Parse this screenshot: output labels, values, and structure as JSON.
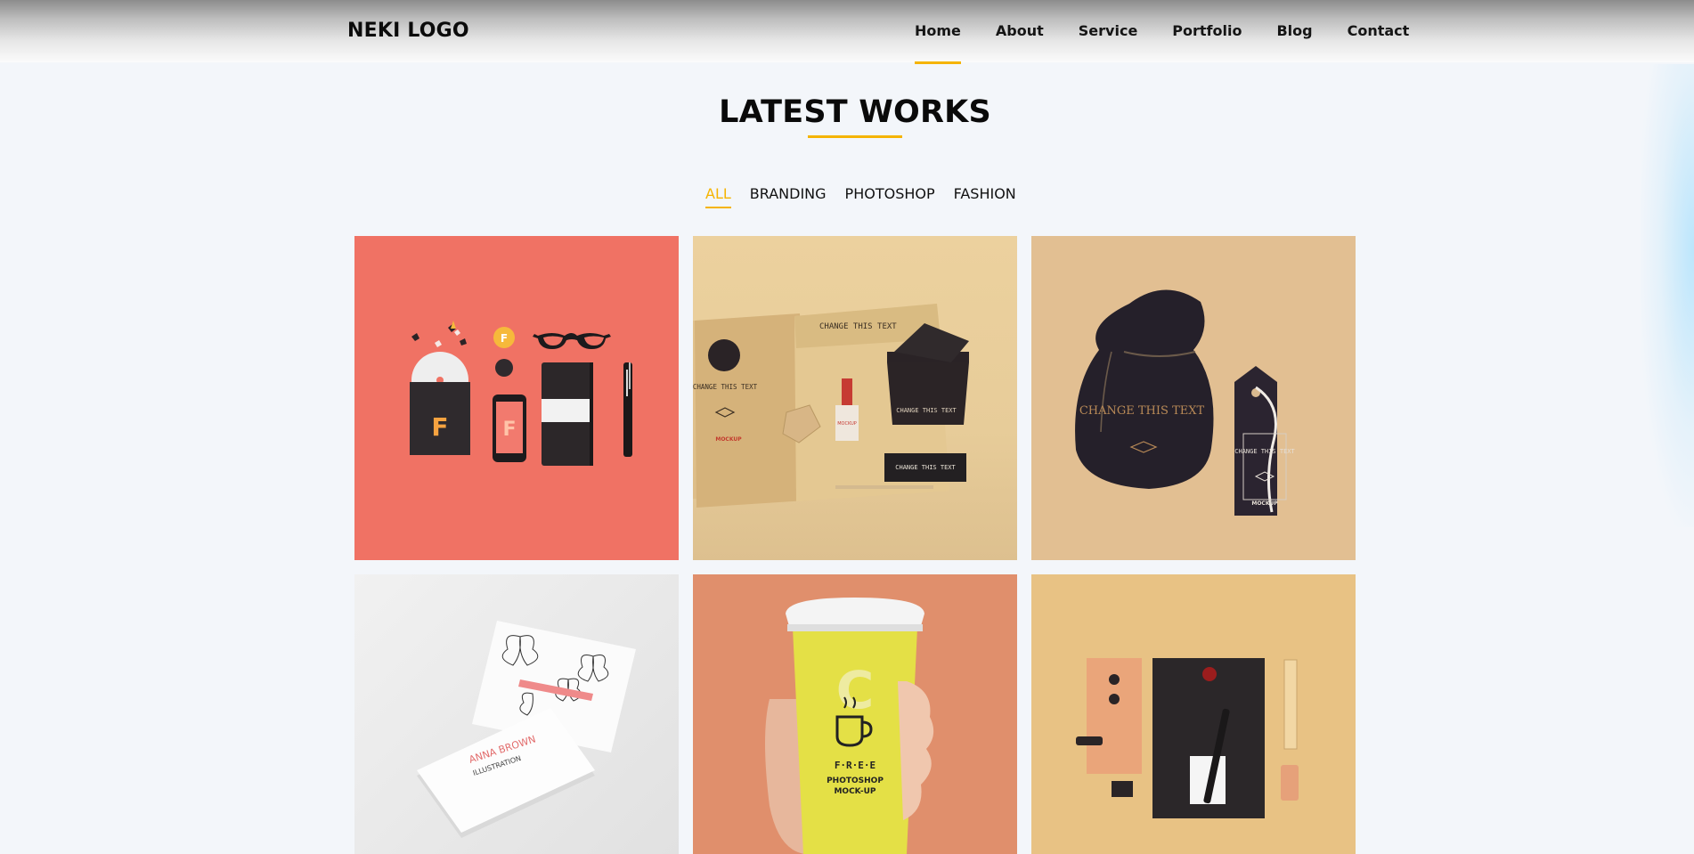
{
  "header": {
    "logo": "NEKI LOGO",
    "nav": [
      {
        "label": "Home",
        "active": true
      },
      {
        "label": "About"
      },
      {
        "label": "Service"
      },
      {
        "label": "Portfolio"
      },
      {
        "label": "Blog"
      },
      {
        "label": "Contact"
      }
    ]
  },
  "section": {
    "title": "LATEST WORKS",
    "filters": [
      {
        "label": "ALL",
        "active": true
      },
      {
        "label": "BRANDING"
      },
      {
        "label": "PHOTOSHOP"
      },
      {
        "label": "FASHION"
      }
    ]
  },
  "tiles": [
    {
      "name": "stationery-flatlay",
      "bg": "#f07264"
    },
    {
      "name": "kraft-packaging",
      "bg": "#e7cc99",
      "texts": {
        "bag_title": "CHANGE THIS TEXT",
        "bag_label": "CHANGE THIS TEXT",
        "bag_mockup": "MOCKUP",
        "ribbon": "MOCKUP",
        "box_title": "CHANGE THIS TEXT",
        "box_front": "CHANGE THIS TEXT"
      }
    },
    {
      "name": "fabric-bag-and-tag",
      "bg": "#e2bf92",
      "texts": {
        "bag": "CHANGE THIS TEXT",
        "tag": "CHANGE THIS TEXT",
        "tag_mockup": "MOCKUP"
      }
    },
    {
      "name": "business-cards",
      "bg": "#e8e8e8",
      "texts": {
        "card_name": "ANNA BROWN",
        "card_sub": "ILLUSTRATION"
      }
    },
    {
      "name": "coffee-cup",
      "bg": "#e08f6c",
      "texts": {
        "free": "F·R·E·E",
        "line1": "PHOTOSHOP",
        "line2": "MOCK-UP"
      }
    },
    {
      "name": "envelope-set",
      "bg": "#e8c284"
    }
  ],
  "colors": {
    "accent": "#f5b400",
    "page_bg": "#f3f6fa"
  }
}
